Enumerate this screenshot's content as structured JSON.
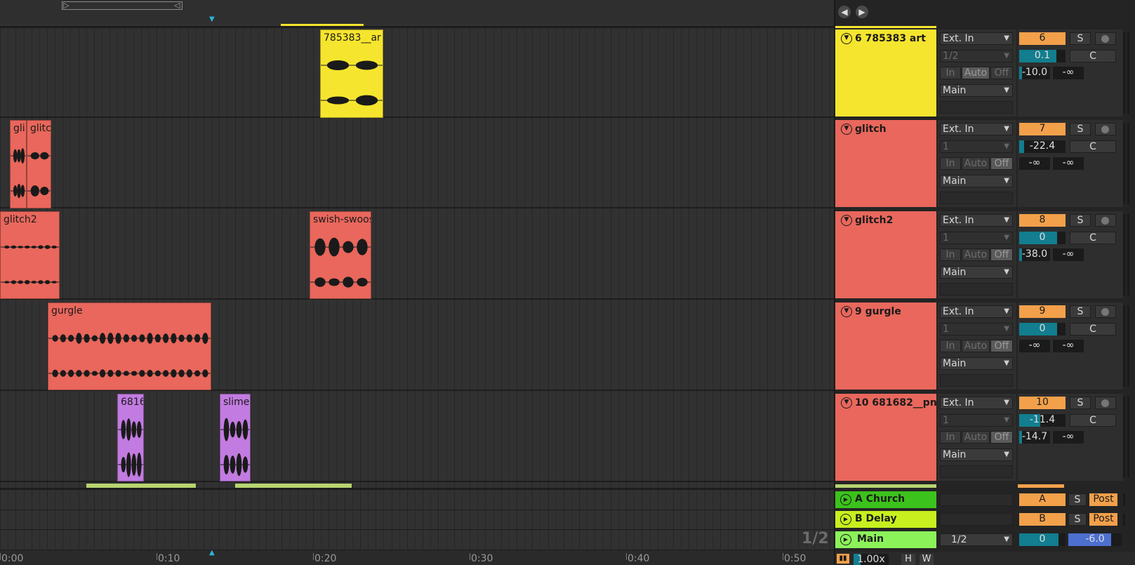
{
  "ruler": {
    "labels": [
      "0:00",
      "0:10",
      "0:20",
      "0:30",
      "0:40",
      "0:50"
    ]
  },
  "arrangement": {
    "page_indicator": "1/2",
    "tracks": [
      {
        "clips": [
          {
            "name": "785383__ar",
            "color": "#f6e52e"
          }
        ]
      },
      {
        "clips": [
          {
            "name": "gli",
            "color": "#e9675c"
          },
          {
            "name": "glitc",
            "color": "#e9675c"
          }
        ]
      },
      {
        "clips": [
          {
            "name": "glitch2",
            "color": "#e9675c"
          },
          {
            "name": "swish-swoos",
            "color": "#e9675c"
          }
        ]
      },
      {
        "clips": [
          {
            "name": "gurgle",
            "color": "#e9675c"
          }
        ]
      },
      {
        "clips": [
          {
            "name": "6816",
            "color": "#c27be0"
          },
          {
            "name": "slime-",
            "color": "#c27be0"
          }
        ]
      }
    ]
  },
  "nav": {
    "back_icon": "arrow-left-icon",
    "forward_icon": "arrow-right-icon"
  },
  "tracks": [
    {
      "name": "6 785383    art",
      "color": "#f6e52e",
      "input": "Ext. In",
      "channel": "1/2",
      "monitor_active": "Auto",
      "output": "Main",
      "number": "6",
      "solo": "S",
      "volume": "0.1",
      "volume_level": 0.8,
      "pan": "C",
      "send_a": "-10.0",
      "send_b": "-∞"
    },
    {
      "name": "glitch",
      "color": "#e9675c",
      "input": "Ext. In",
      "channel": "1",
      "monitor_active": "Off",
      "output": "Main",
      "number": "7",
      "solo": "S",
      "volume": "-22.4",
      "volume_level": 0.1,
      "pan": "C",
      "send_a": "-∞",
      "send_b": "-∞"
    },
    {
      "name": "glitch2",
      "color": "#e9675c",
      "input": "Ext. In",
      "channel": "1",
      "monitor_active": "Off",
      "output": "Main",
      "number": "8",
      "solo": "S",
      "volume": "0",
      "volume_level": 0.82,
      "pan": "C",
      "send_a": "-38.0",
      "send_b": "-∞"
    },
    {
      "name": "9 gurgle",
      "color": "#e9675c",
      "input": "Ext. In",
      "channel": "1",
      "monitor_active": "Off",
      "output": "Main",
      "number": "9",
      "solo": "S",
      "volume": "0",
      "volume_level": 0.82,
      "pan": "C",
      "send_a": "-∞",
      "send_b": "-∞"
    },
    {
      "name": "10 681682__pn",
      "color": "#e9675c",
      "input": "Ext. In",
      "channel": "1",
      "monitor_active": "Off",
      "output": "Main",
      "number": "10",
      "solo": "S",
      "volume": "-11.4",
      "volume_level": 0.45,
      "pan": "C",
      "send_a": "-14.7",
      "send_b": "-∞"
    }
  ],
  "monitor_labels": {
    "in": "In",
    "auto": "Auto",
    "off": "Off"
  },
  "returns": [
    {
      "name": "A Church",
      "color": "#3cc21c",
      "letter": "A",
      "solo": "S",
      "post": "Post"
    },
    {
      "name": "B Delay",
      "color": "#c7f01e",
      "letter": "B",
      "solo": "S",
      "post": "Post"
    }
  ],
  "main": {
    "name": "Main",
    "color": "#8cf25a",
    "channel": "1/2",
    "volume": "0",
    "pan": "-6.0"
  },
  "footer": {
    "zoom": "1.00x",
    "h": "H",
    "w": "W"
  }
}
